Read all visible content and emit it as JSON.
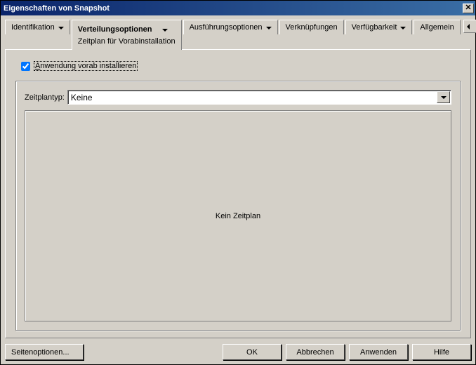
{
  "window": {
    "title": "Eigenschaften von Snapshot"
  },
  "tabs": {
    "identification": "Identifikation",
    "distribution": "Verteilungsoptionen",
    "distribution_sub": "Zeitplan für Vorabinstallation",
    "execution": "Ausführungsoptionen",
    "links": "Verknüpfungen",
    "availability": "Verfügbarkeit",
    "general": "Allgemein"
  },
  "main": {
    "preinstall_checkbox_prefix": "A",
    "preinstall_checkbox_rest": "nwendung vorab installieren",
    "schedule_type_label": "Zeitplantyp:",
    "schedule_type_value": "Keine",
    "plan_empty_text": "Kein Zeitplan"
  },
  "buttons": {
    "page_options": "Seitenoptionen...",
    "ok": "OK",
    "cancel": "Abbrechen",
    "apply": "Anwenden",
    "help": "Hilfe"
  }
}
